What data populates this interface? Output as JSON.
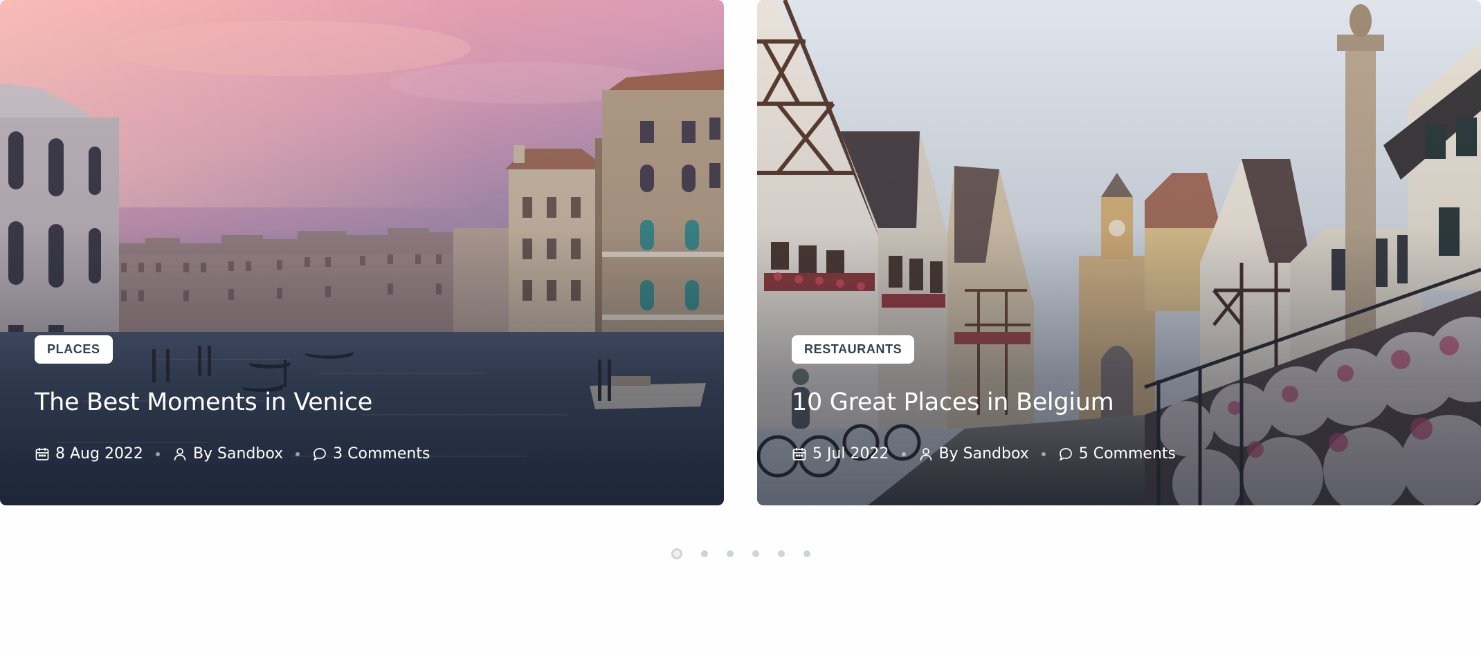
{
  "posts": [
    {
      "category": "PLACES",
      "title": "The Best Moments in Venice",
      "date": "8 Aug 2022",
      "author": "By Sandbox",
      "comments": "3 Comments",
      "icons": {
        "date": "calendar-icon",
        "author": "user-icon",
        "comments": "comment-bubble-icon"
      }
    },
    {
      "category": "RESTAURANTS",
      "title": "10 Great Places in Belgium",
      "date": "5 Jul 2022",
      "author": "By Sandbox",
      "comments": "5 Comments",
      "icons": {
        "date": "calendar-icon",
        "author": "user-icon",
        "comments": "comment-bubble-icon"
      }
    }
  ],
  "carousel": {
    "page_count": 6,
    "active_page": 1
  },
  "colors": {
    "badge_text": "#343f52",
    "badge_bg": "#ffffff",
    "title_text": "#ffffff",
    "pager_dot": "#cfd3da",
    "page_background": "#fefefe"
  }
}
